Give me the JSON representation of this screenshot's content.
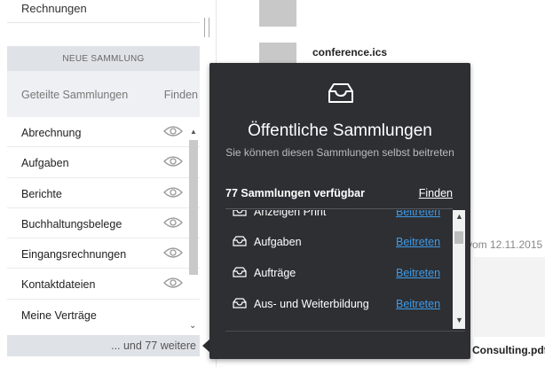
{
  "sidebar": {
    "top_item": "Rechnungen",
    "new_collection_label": "NEUE SAMMLUNG",
    "shared_title": "Geteilte Sammlungen",
    "shared_find": "Finden",
    "items": [
      {
        "label": "Abrechnung"
      },
      {
        "label": "Aufgaben"
      },
      {
        "label": "Berichte"
      },
      {
        "label": "Buchhaltungsbelege"
      },
      {
        "label": "Eingangsrechnungen"
      },
      {
        "label": "Kontaktdateien"
      },
      {
        "label": "Meine Verträge"
      }
    ],
    "more_label": "... und 77 weitere"
  },
  "content": {
    "file1_name": "conference.ics",
    "file2_meta": "vom 12.11.2015",
    "file3_name": "Consulting.pdf"
  },
  "popover": {
    "title": "Öffentliche Sammlungen",
    "subtitle": "Sie können diesen Sammlungen selbst beitreten",
    "count_label": "77 Sammlungen verfügbar",
    "find_label": "Finden",
    "join_label": "Beitreten",
    "items": [
      {
        "label": "Anzeigen Print"
      },
      {
        "label": "Aufgaben"
      },
      {
        "label": "Aufträge"
      },
      {
        "label": "Aus- und Weiterbildung"
      }
    ]
  },
  "colors": {
    "popover_bg": "#2e2f33",
    "link": "#3d9be9"
  }
}
